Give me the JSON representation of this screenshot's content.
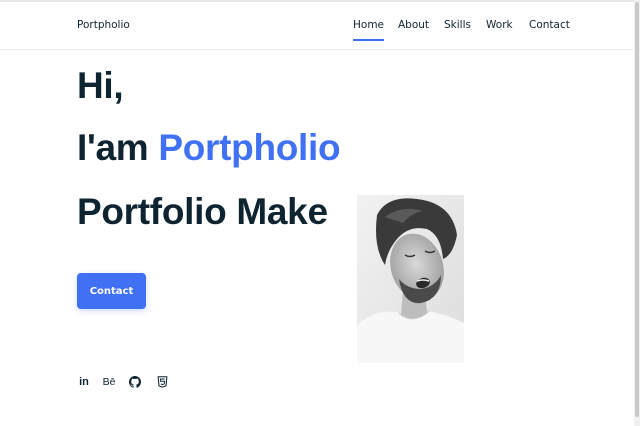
{
  "header": {
    "logo": "Portpholio",
    "nav": [
      {
        "label": "Home",
        "active": true
      },
      {
        "label": "About",
        "active": false
      },
      {
        "label": "Skills",
        "active": false
      },
      {
        "label": "Work",
        "active": false
      },
      {
        "label": "Contact",
        "active": false
      }
    ]
  },
  "hero": {
    "greeting": "Hi,",
    "intro_prefix": "I'am",
    "intro_name": "Portpholio",
    "tagline": "Portfolio Make",
    "contact_button": "Contact"
  },
  "social": {
    "linkedin": "in",
    "behance": "Bē",
    "github_icon": "github-icon",
    "html5_icon": "html5-icon"
  },
  "colors": {
    "accent": "#4070f4",
    "text": "#0e2431",
    "background": "#ffffff"
  }
}
